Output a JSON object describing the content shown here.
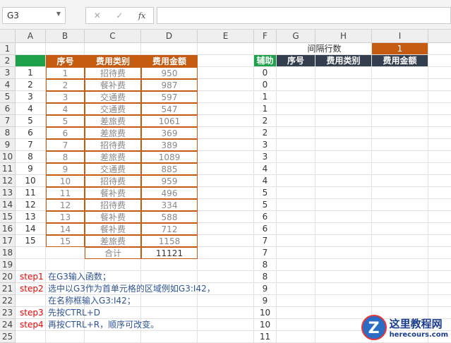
{
  "namebox": "G3",
  "formula_icons": {
    "cancel": "✕",
    "enter": "✓",
    "fx": "fx"
  },
  "columns": [
    "A",
    "B",
    "C",
    "D",
    "E",
    "F",
    "G",
    "H",
    "I"
  ],
  "rows": [
    "1",
    "2",
    "3",
    "4",
    "5",
    "6",
    "7",
    "8",
    "9",
    "10",
    "11",
    "12",
    "13",
    "14",
    "15",
    "16",
    "17",
    "18",
    "19",
    "20",
    "21",
    "22",
    "23",
    "24",
    "25"
  ],
  "left_table": {
    "headers": [
      "序号",
      "费用类别",
      "费用金额"
    ],
    "a_col": [
      "1",
      "2",
      "3",
      "4",
      "5",
      "6",
      "7",
      "8",
      "9",
      "10",
      "11",
      "12",
      "13",
      "14",
      "15"
    ],
    "rows": [
      [
        "1",
        "招待费",
        "950"
      ],
      [
        "2",
        "餐补费",
        "987"
      ],
      [
        "3",
        "交通费",
        "597"
      ],
      [
        "4",
        "交通费",
        "547"
      ],
      [
        "5",
        "差旅费",
        "1061"
      ],
      [
        "6",
        "差旅费",
        "369"
      ],
      [
        "7",
        "招待费",
        "389"
      ],
      [
        "8",
        "差旅费",
        "1089"
      ],
      [
        "9",
        "交通费",
        "885"
      ],
      [
        "10",
        "招待费",
        "959"
      ],
      [
        "11",
        "餐补费",
        "496"
      ],
      [
        "12",
        "招待费",
        "334"
      ],
      [
        "13",
        "餐补费",
        "588"
      ],
      [
        "14",
        "餐补费",
        "712"
      ],
      [
        "15",
        "差旅费",
        "1158"
      ]
    ],
    "total_label": "合计",
    "total_value": "11121"
  },
  "right_table": {
    "interval_label": "间隔行数",
    "interval_value": "1",
    "helper_header": "辅助",
    "headers": [
      "序号",
      "费用类别",
      "费用金额"
    ],
    "helper_values": [
      "0",
      "0",
      "1",
      "1",
      "2",
      "2",
      "3",
      "3",
      "4",
      "4",
      "5",
      "5",
      "6",
      "6",
      "7",
      "7",
      "8",
      "8",
      "9",
      "9",
      "10",
      "10",
      "11"
    ]
  },
  "steps": [
    {
      "label": "step1",
      "text": "在G3输入函数；"
    },
    {
      "label": "step2",
      "text": "选中以G3作为首单元格的区域例如G3:I42，"
    },
    {
      "label": "",
      "text": "在名称框输入G3:I42；"
    },
    {
      "label": "step3",
      "text": "先按CTRL+D"
    },
    {
      "label": "step4",
      "text": "再按CTRL+R，顺序可改变。"
    }
  ],
  "watermark": {
    "logo": "Z",
    "title": "这里教程网",
    "url": "herecours.com"
  },
  "colors": {
    "orange": "#c55a11",
    "dark": "#333f4f",
    "green": "#1fa04a"
  }
}
